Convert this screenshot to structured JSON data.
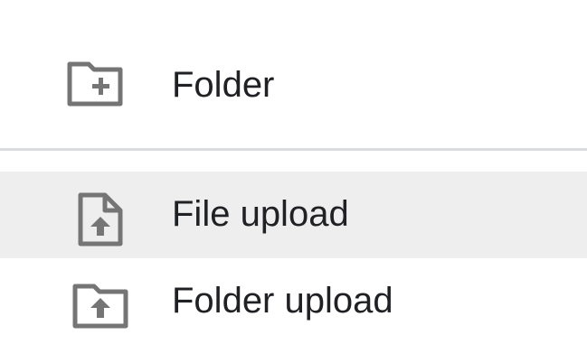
{
  "menu": {
    "items": [
      {
        "label": "Folder",
        "icon": "folder-plus-icon",
        "highlighted": false
      },
      {
        "label": "File upload",
        "icon": "file-upload-icon",
        "highlighted": true
      },
      {
        "label": "Folder upload",
        "icon": "folder-upload-icon",
        "highlighted": false
      }
    ]
  },
  "colors": {
    "icon": "#757575",
    "text": "#202124",
    "highlight_bg": "#eeeeee",
    "divider": "#dadce0"
  }
}
